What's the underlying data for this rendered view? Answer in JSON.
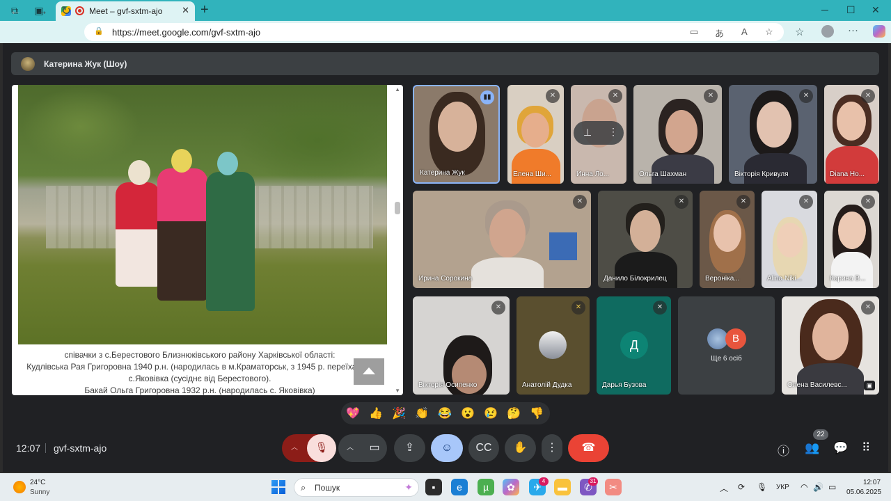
{
  "browser": {
    "tab_title": "Meet – gvf-sxtm-ajo",
    "url": "https://meet.google.com/gvf-sxtm-ajo"
  },
  "presentation": {
    "presenter_label": "Катерина Жук (Шоу)",
    "caption": [
      "співачки з с.Берестового Близнюківського району Харківської області:",
      "Кудлівська Рая Григоровна 1940 р.н. (народилась в м.Краматорськ, з 1945 р. переїхала в",
      "с.Яковівка (сусіднє від Берестового).",
      "Бакай Ольга Григоровна 1932 р.н. (народилась с. Яковівка)"
    ]
  },
  "participants": [
    {
      "name": "Катерина Жук"
    },
    {
      "name": "Елена Ши..."
    },
    {
      "name": "Инна Ло..."
    },
    {
      "name": "Ольга Шахман"
    },
    {
      "name": "Вікторія Кривуля"
    },
    {
      "name": "Diana Ho..."
    },
    {
      "name": "Ирина Сорокина"
    },
    {
      "name": "Данило Білокрилец"
    },
    {
      "name": "Вероніка..."
    },
    {
      "name": "Alina Niki..."
    },
    {
      "name": "Карина В..."
    },
    {
      "name": "Вікторія Осипенко"
    },
    {
      "name": "Анатолій Дудка"
    },
    {
      "name": "Дарья Бузова",
      "initial": "Д"
    },
    {
      "name": "Олена Василевс..."
    }
  ],
  "others": {
    "label": "Ще 6 осіб",
    "avatar_initial": "В"
  },
  "reactions": [
    "💖",
    "👍",
    "🎉",
    "👏",
    "😂",
    "😮",
    "😢",
    "🤔",
    "👎"
  ],
  "meeting": {
    "time": "12:07",
    "code": "gvf-sxtm-ajo",
    "participant_count": "22"
  },
  "taskbar": {
    "temperature": "24°C",
    "condition": "Sunny",
    "search_placeholder": "Пошук",
    "telegram_badge": "4",
    "viber_badge": "31",
    "language": "УКР",
    "time": "12:07",
    "date": "05.06.2025"
  },
  "colors": {
    "end_call": "#ea4335",
    "accent_blue": "#8ab4f8",
    "teal_tile": "#0f6b60",
    "tabbar": "#31b3bc"
  }
}
